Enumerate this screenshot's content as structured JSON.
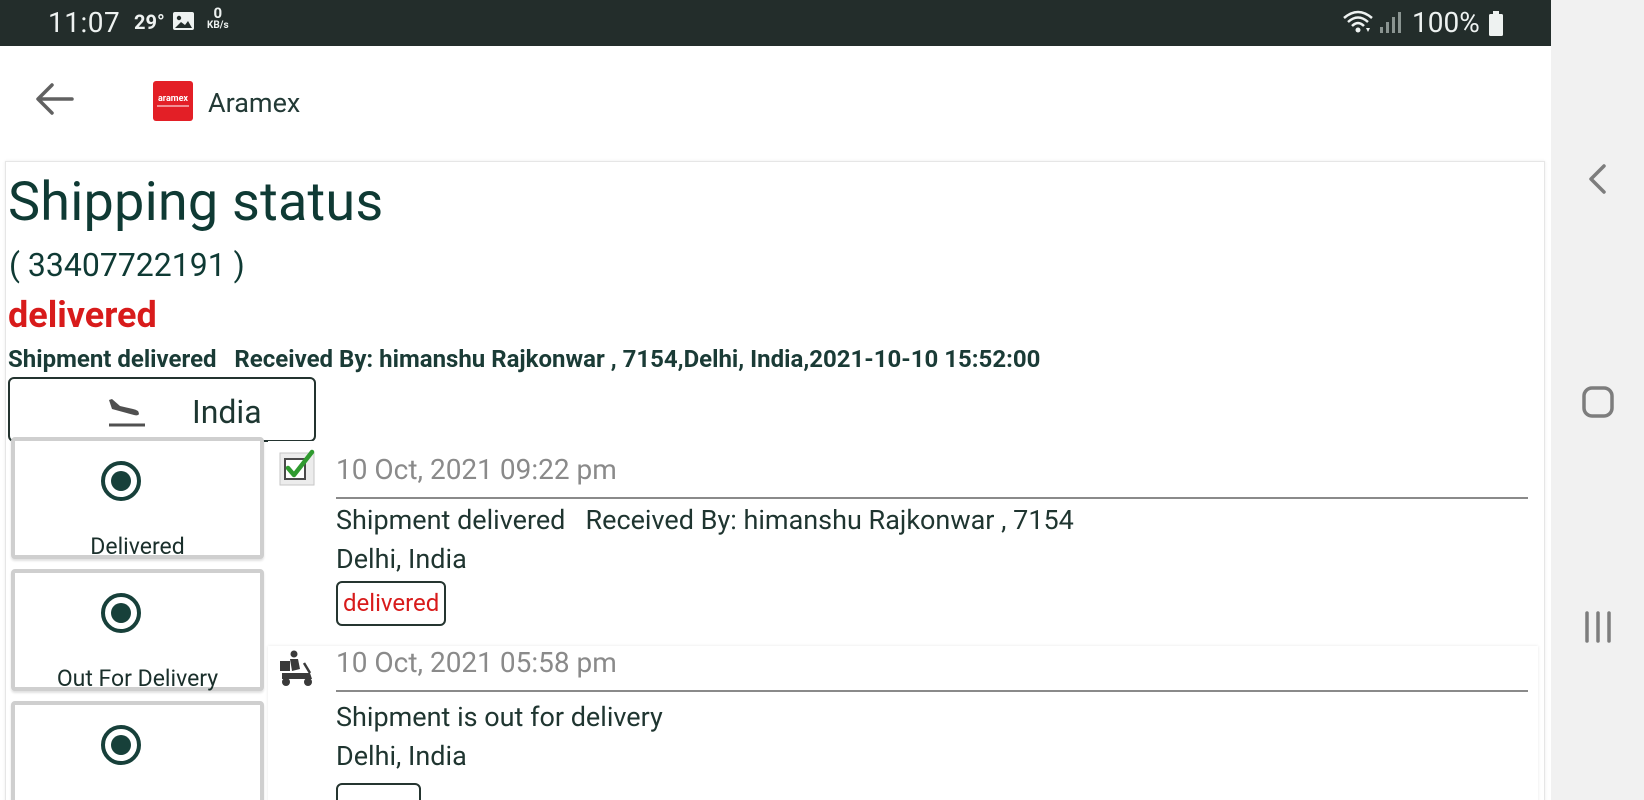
{
  "status_bar": {
    "time": "11:07",
    "temperature": "29°",
    "net_speed_value": "0",
    "net_speed_unit": "KB/s",
    "battery": "100%"
  },
  "toolbar": {
    "back_icon": "arrow-left",
    "logo_text": "aramex",
    "title": "Aramex"
  },
  "shipment": {
    "title": "Shipping status",
    "tracking": "( 33407722191 )",
    "status": "delivered",
    "description": "Shipment delivered   Received By: himanshu Rajkonwar , 7154,Delhi, India,2021-10-10 15:52:00",
    "destination": "India",
    "destination_icon": "flight-land"
  },
  "steps": [
    {
      "label": "Delivered",
      "icon": "radio-checked"
    },
    {
      "label": "Out For Delivery",
      "icon": "radio-checked"
    },
    {
      "label": "",
      "icon": "radio-checked"
    }
  ],
  "events": [
    {
      "time": "10 Oct, 2021 09:22 pm",
      "description": "Shipment delivered   Received By: himanshu Rajkonwar , 7154",
      "location": "Delhi, India",
      "badge": "delivered",
      "icon": "check-box"
    },
    {
      "time": "10 Oct, 2021 05:58 pm",
      "description": "Shipment is out for delivery",
      "location": "Delhi, India",
      "badge": "",
      "icon": "delivery-scooter"
    }
  ],
  "colors": {
    "status_bar": "#232d2b",
    "primary_text": "#0f3a34",
    "delivered_red": "#d81b1b",
    "logo_red": "#e31f26"
  }
}
